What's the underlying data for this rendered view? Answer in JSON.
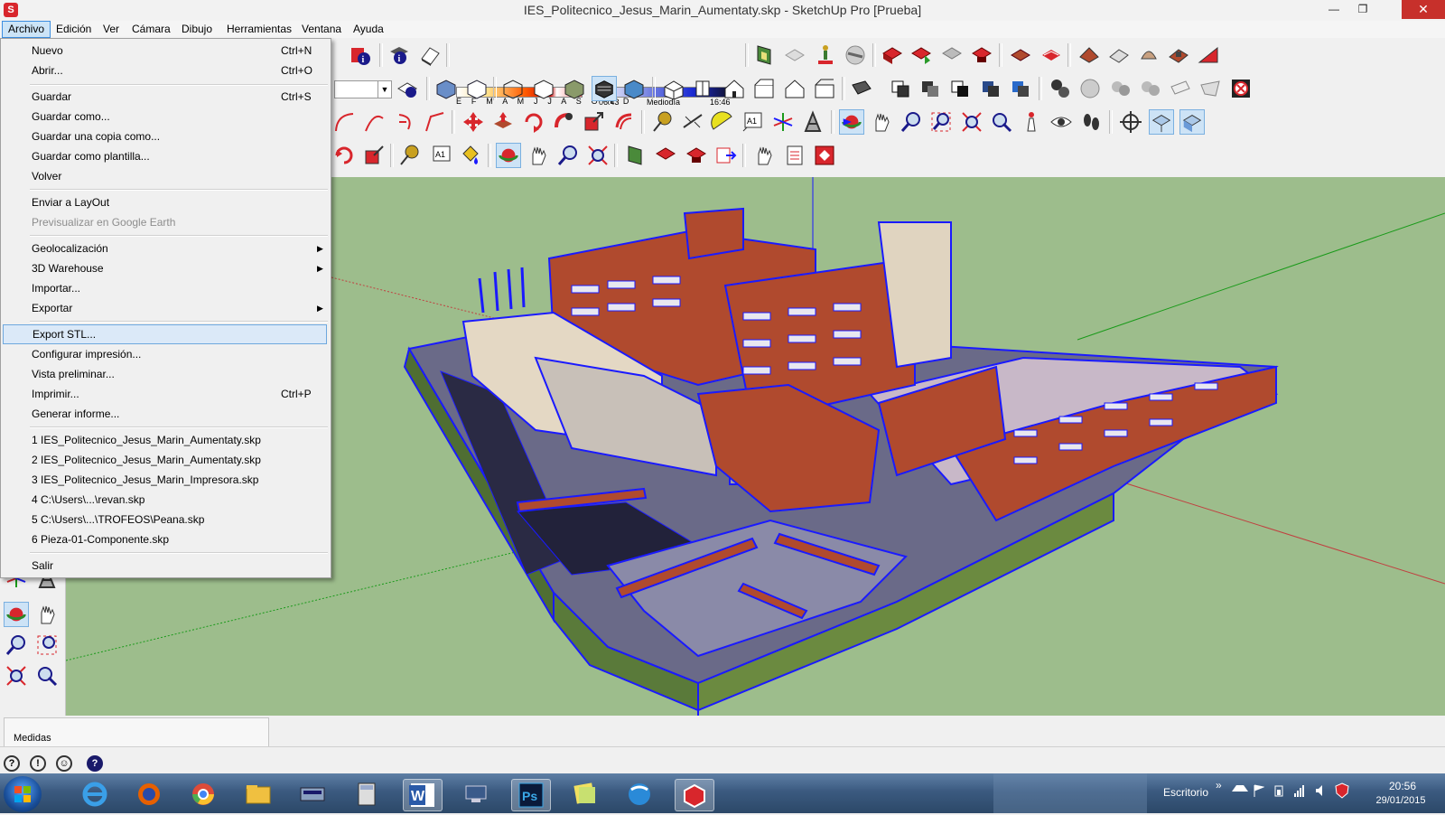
{
  "window": {
    "title": "IES_Politecnico_Jesus_Marin_Aumentaty.skp - SketchUp Pro [Prueba]",
    "controls": {
      "minimize": "—",
      "restore": "❐",
      "close": "✕"
    }
  },
  "menubar": [
    "Archivo",
    "Edición",
    "Ver",
    "Cámara",
    "Dibujo",
    "Herramientas",
    "Ventana",
    "Ayuda"
  ],
  "file_menu": {
    "items": [
      {
        "label": "Nuevo",
        "shortcut": "Ctrl+N"
      },
      {
        "label": "Abrir...",
        "shortcut": "Ctrl+O"
      },
      {
        "label": "Guardar",
        "shortcut": "Ctrl+S"
      },
      {
        "label": "Guardar como...",
        "shortcut": ""
      },
      {
        "label": "Guardar una copia como...",
        "shortcut": ""
      },
      {
        "label": "Guardar como plantilla...",
        "shortcut": ""
      },
      {
        "label": "Volver",
        "shortcut": ""
      },
      {
        "label": "Enviar a LayOut",
        "shortcut": ""
      },
      {
        "label": "Previsualizar en Google Earth",
        "shortcut": "",
        "disabled": true
      },
      {
        "label": "Geolocalización",
        "shortcut": "",
        "submenu": true
      },
      {
        "label": "3D Warehouse",
        "shortcut": "",
        "submenu": true
      },
      {
        "label": "Importar...",
        "shortcut": ""
      },
      {
        "label": "Exportar",
        "shortcut": "",
        "submenu": true
      },
      {
        "label": "Export STL...",
        "shortcut": "",
        "highlighted": true
      },
      {
        "label": "Configurar impresión...",
        "shortcut": ""
      },
      {
        "label": "Vista preliminar...",
        "shortcut": ""
      },
      {
        "label": "Imprimir...",
        "shortcut": "Ctrl+P"
      },
      {
        "label": "Generar informe...",
        "shortcut": ""
      },
      {
        "label": "1 IES_Politecnico_Jesus_Marin_Aumentaty.skp",
        "shortcut": ""
      },
      {
        "label": "2 IES_Politecnico_Jesus_Marin_Aumentaty.skp",
        "shortcut": ""
      },
      {
        "label": "3 IES_Politecnico_Jesus_Marin_Impresora.skp",
        "shortcut": ""
      },
      {
        "label": "4 C:\\Users\\...\\revan.skp",
        "shortcut": ""
      },
      {
        "label": "5 C:\\Users\\...\\TROFEOS\\Peana.skp",
        "shortcut": ""
      },
      {
        "label": "6 Pieza-01-Componente.skp",
        "shortcut": ""
      },
      {
        "label": "Salir",
        "shortcut": ""
      }
    ],
    "submenu_arrow": "▶"
  },
  "shadows": {
    "months": "E F M A M J J A S O N D",
    "time_start": "06:43",
    "time_mid": "Mediodía",
    "time_end": "16:46"
  },
  "toolbar_text": {
    "text_tool": "A1",
    "select_arrow": "▼"
  },
  "measurements": {
    "label": "Medidas"
  },
  "status_icons": [
    "?",
    "!",
    "☺",
    "?"
  ],
  "taskbar": {
    "tray_label": "Escritorio",
    "tray_chevron": "»",
    "time": "20:56",
    "date": "29/01/2015",
    "apps": [
      "ie",
      "firefox",
      "chrome",
      "explorer",
      "scanner",
      "calculator",
      "word",
      "remote-desktop",
      "photoshop",
      "sticky-notes",
      "browser",
      "sketchup"
    ],
    "labels": {
      "word": "W",
      "photoshop": "Ps"
    }
  },
  "colors": {
    "viewport": "#9dbd8c",
    "building_brick": "#b04a2e",
    "edges": "#1a1aff",
    "highlight": "#dbe9f8"
  }
}
